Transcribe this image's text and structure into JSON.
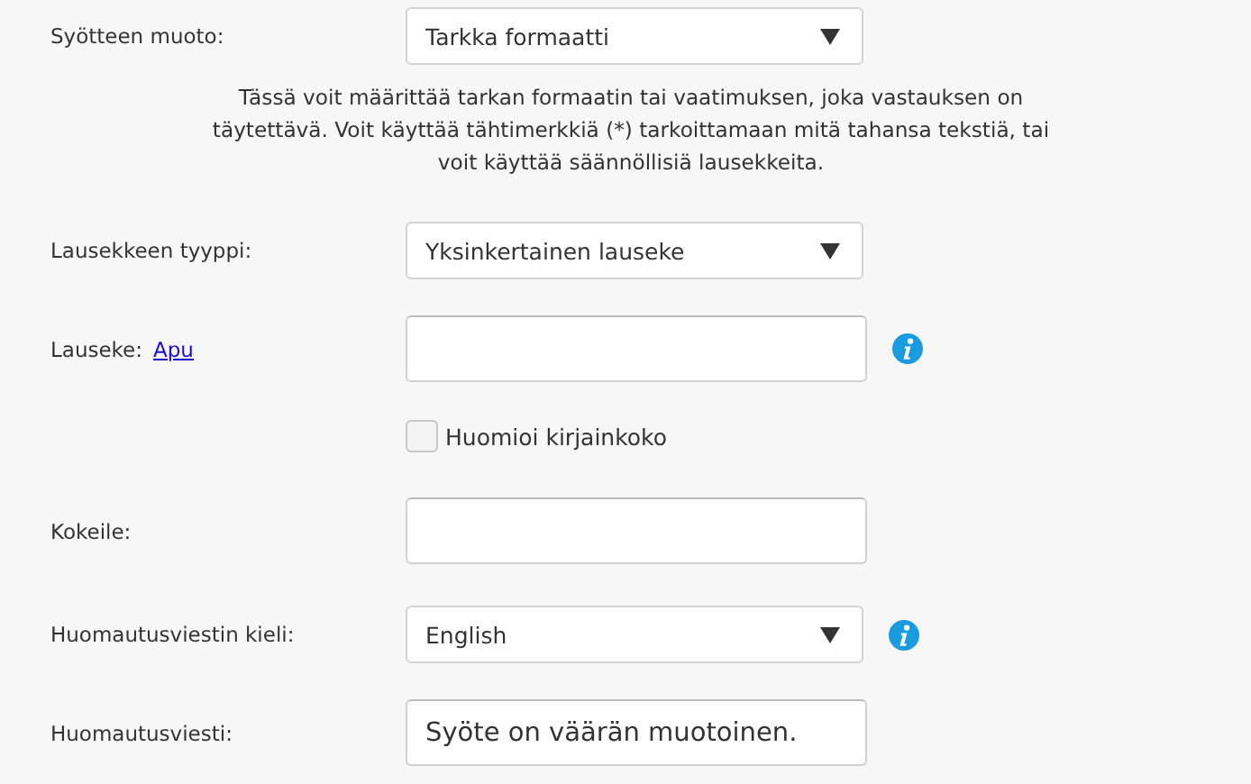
{
  "rows": [
    {
      "kind": "select",
      "label": "Syötteen muoto:",
      "value": "Tarkka formaatti",
      "info": false
    },
    {
      "kind": "help",
      "text": "Tässä voit määrittää tarkan formaatin tai vaatimuksen, joka vastauksen on täytettävä. Voit käyttää tähtimerkkiä (*) tarkoittamaan mitä tahansa tekstiä, tai voit käyttää säännöllisiä lausekkeita."
    },
    {
      "kind": "select",
      "label": "Lausekkeen tyyppi:",
      "value": "Yksinkertainen lauseke",
      "info": false
    },
    {
      "kind": "input",
      "label": "Lauseke:",
      "link": "Apu",
      "info": true
    },
    {
      "kind": "checkbox",
      "label": "Huomioi kirjainkoko",
      "checked": false
    },
    {
      "kind": "input",
      "label": "Kokeile:",
      "info": false
    },
    {
      "kind": "select",
      "label": "Huomautusviestin kieli:",
      "value": "English",
      "info": true
    },
    {
      "kind": "input",
      "label": "Huomautusviesti:",
      "value": "Syöte on väärän muotoinen.",
      "info": false
    }
  ]
}
